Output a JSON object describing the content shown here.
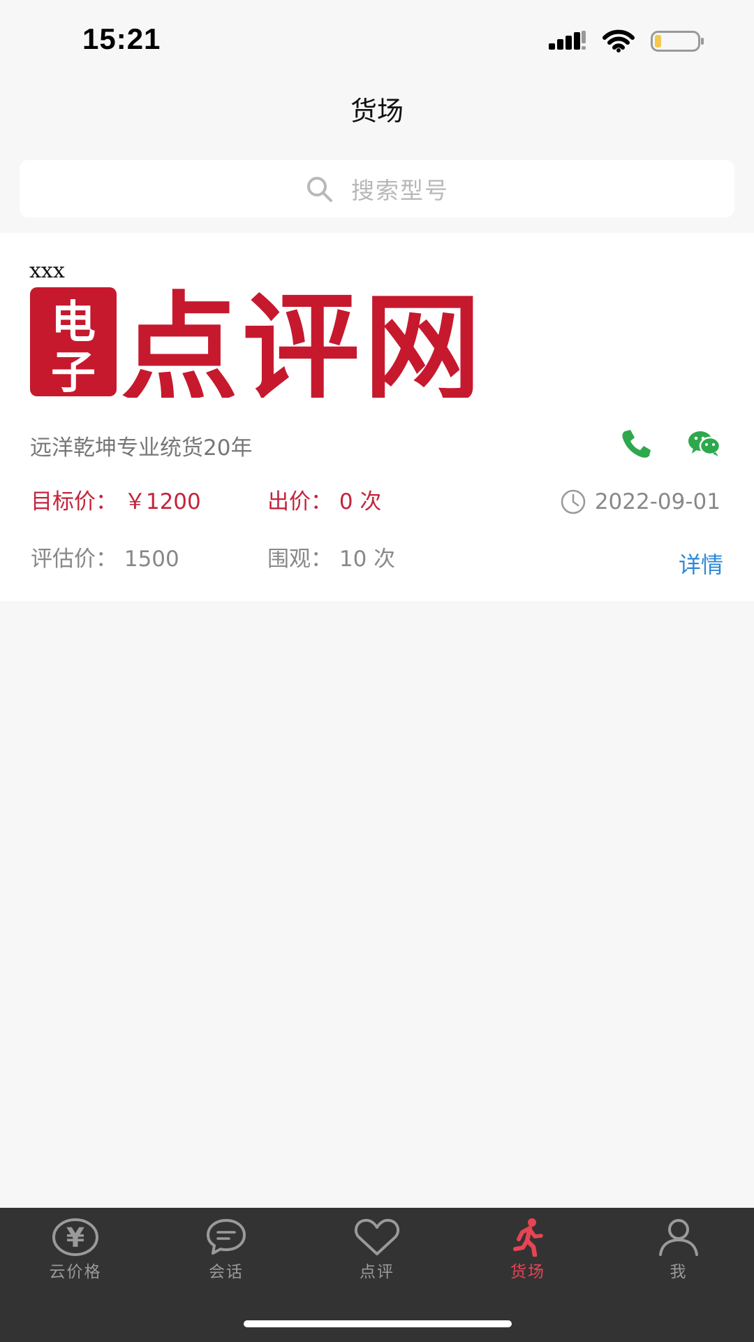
{
  "status_bar": {
    "time": "15:21"
  },
  "header": {
    "title": "货场"
  },
  "search": {
    "placeholder": "搜索型号"
  },
  "listing": {
    "label": "xxx",
    "image_text": "电子点评网",
    "seller_desc": "远洋乾坤专业统货20年",
    "target_price_label": "目标价：",
    "target_price_value": "￥1200",
    "bids_label": "出价：",
    "bids_value": "0 次",
    "date": "2022-09-01",
    "estimated_label": "评估价：",
    "estimated_value": "1500",
    "views_label": "围观：",
    "views_value": "10 次",
    "detail_link": "详情"
  },
  "tabbar": {
    "items": [
      {
        "label": "云价格",
        "icon": "yen-icon"
      },
      {
        "label": "会话",
        "icon": "chat-icon"
      },
      {
        "label": "点评",
        "icon": "heart-icon"
      },
      {
        "label": "货场",
        "icon": "running-person-icon",
        "active": true
      },
      {
        "label": "我",
        "icon": "person-icon"
      }
    ]
  },
  "colors": {
    "accent_red": "#c4243a",
    "tab_active": "#e74454",
    "link_blue": "#2d88d8",
    "icon_green": "#2ea84d",
    "tabbar_bg": "#333333",
    "page_bg": "#f7f7f7"
  }
}
